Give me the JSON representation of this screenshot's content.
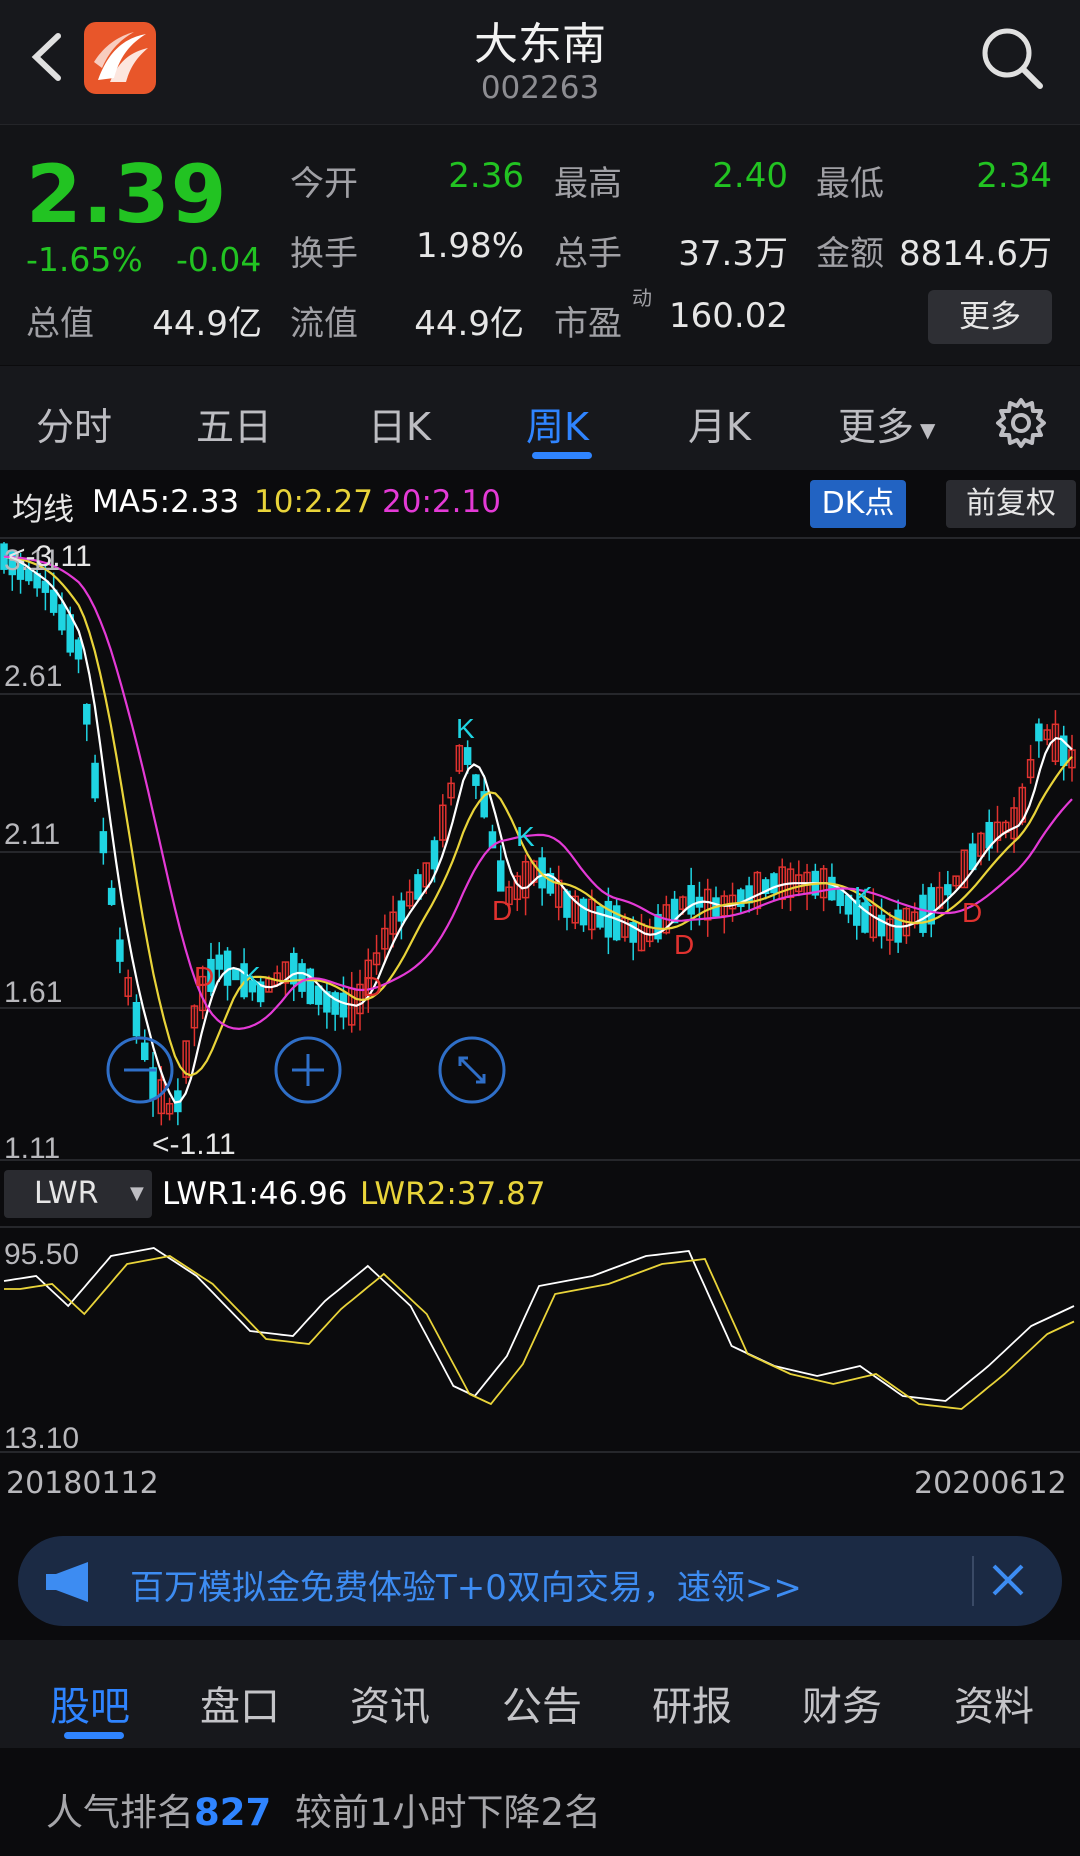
{
  "header": {
    "title": "大东南",
    "code": "002263",
    "back_icon": "chevron-left-icon",
    "logo_icon": "app-logo-icon",
    "search_icon": "search-icon"
  },
  "quote": {
    "price": "2.39",
    "change_pct": "-1.65%",
    "change": "-0.04",
    "stats": [
      {
        "label": "今开",
        "value": "2.36"
      },
      {
        "label": "最高",
        "value": "2.40"
      },
      {
        "label": "最低",
        "value": "2.34"
      },
      {
        "label": "换手",
        "value": "1.98%"
      },
      {
        "label": "总手",
        "value": "37.3万"
      },
      {
        "label": "金额",
        "value": "8814.6万"
      },
      {
        "label": "总值",
        "value": "44.9亿"
      },
      {
        "label": "流值",
        "value": "44.9亿"
      },
      {
        "label": "市盈",
        "value": "160.02",
        "sup": "动"
      }
    ],
    "more_label": "更多"
  },
  "tabs": {
    "items": [
      "分时",
      "五日",
      "日K",
      "周K",
      "月K",
      "更多"
    ],
    "active": "周K",
    "settings_icon": "gear-icon"
  },
  "ma": {
    "label": "均线",
    "ma5": "MA5:2.33",
    "ma10": "10:2.27",
    "ma20": "20:2.10",
    "dk_label": "DK点",
    "fq_label": "前复权"
  },
  "kline": {
    "ylabels": [
      "3.11",
      "2.61",
      "2.11",
      "1.61",
      "1.11"
    ],
    "high_marker": "<-3.11",
    "low_marker": "<-1.11",
    "k_marker": "K",
    "d_marker": "D"
  },
  "indicator": {
    "select": "LWR",
    "lwr1": "LWR1:46.96",
    "lwr2": "LWR2:37.87",
    "ymax": "95.50",
    "ymin": "13.10"
  },
  "dates": {
    "start": "20180112",
    "end": "20200612"
  },
  "banner": {
    "text": "百万模拟金免费体验T+0双向交易，速领>>",
    "speaker_icon": "megaphone-icon",
    "close_icon": "close-icon"
  },
  "bottom_tabs": {
    "items": [
      "股吧",
      "盘口",
      "资讯",
      "公告",
      "研报",
      "财务",
      "资料"
    ],
    "active": "股吧"
  },
  "popularity": {
    "prefix": "人气排名",
    "rank": "827",
    "suffix": "较前1小时下降2名"
  },
  "colors": {
    "up": "#e0322f",
    "down": "#1fd4e2",
    "ma5": "#ffffff",
    "ma10": "#e9d43a",
    "ma20": "#e43ad6",
    "accent": "#2f84ff",
    "price_down": "#22c322"
  }
}
